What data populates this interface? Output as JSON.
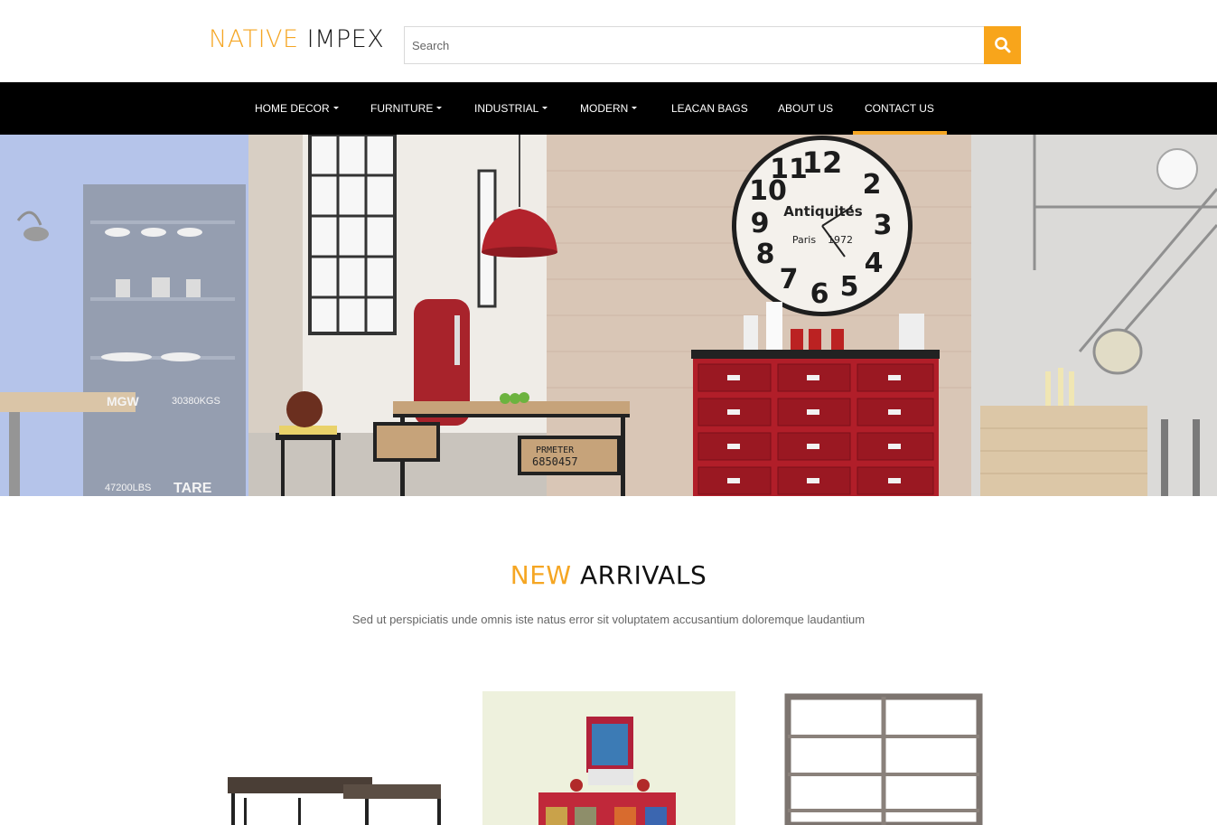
{
  "brand": {
    "part1": "NATIVE",
    "part2": "IMPEX"
  },
  "search": {
    "placeholder": "Search",
    "value": "",
    "icon": "search-icon"
  },
  "nav": {
    "items": [
      {
        "label": "HOME DECOR",
        "dropdown": true
      },
      {
        "label": "FURNITURE",
        "dropdown": true
      },
      {
        "label": "INDUSTRIAL",
        "dropdown": true
      },
      {
        "label": "MODERN",
        "dropdown": true
      },
      {
        "label": "LEACAN BAGS",
        "dropdown": false
      },
      {
        "label": "ABOUT US",
        "dropdown": false
      },
      {
        "label": "CONTACT US",
        "dropdown": false,
        "active": true
      }
    ]
  },
  "hero": {
    "clock_text": "Antiquités",
    "clock_sub": "Paris",
    "clock_year": "1972",
    "crate_text1": "MGW",
    "crate_text2": "30380KGS",
    "crate_text3": "TARE",
    "crate_text4": "47200LBS",
    "stool_text1": "PRMETER",
    "stool_text2": "6850457"
  },
  "arrivals": {
    "title_accent": "NEW",
    "title_main": "ARRIVALS",
    "subtitle": "Sed ut perspiciatis unde omnis iste natus error sit voluptatem accusantium doloremque laudantium"
  },
  "colors": {
    "accent": "#f5a623",
    "nav_bg": "#000000",
    "search_btn": "#f8a51b"
  }
}
